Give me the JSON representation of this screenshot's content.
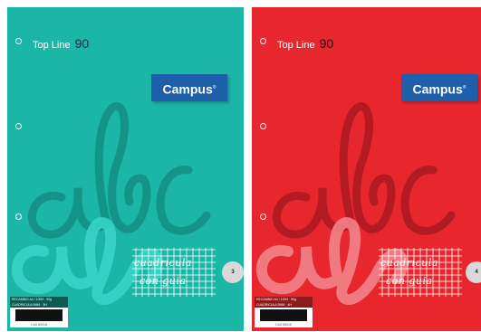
{
  "covers": [
    {
      "variant": "teal",
      "background": "#1bb6a6",
      "line_name": "Top Line",
      "line_number": "90",
      "brand": "Campus",
      "brand_mark": "®",
      "script_text": "abc",
      "grid_text_1": "cuadricula",
      "grid_text_2": "con guia",
      "badge": "3",
      "label_line_1": "RECAMBIO A4 / 100H · 90g",
      "label_line_2": "CUADRICULA 5MM · 3H",
      "label_footer": "CAS 89018"
    },
    {
      "variant": "red",
      "background": "#e8262e",
      "line_name": "Top Line",
      "line_number": "90",
      "brand": "Campus",
      "brand_mark": "®",
      "script_text": "abc",
      "grid_text_1": "cuadricula",
      "grid_text_2": "con guia",
      "badge": "4",
      "label_line_1": "RECAMBIO A4 / 100H · 90g",
      "label_line_2": "CUADRICULA 5MM · 4H",
      "label_footer": "CAS 89018"
    }
  ]
}
